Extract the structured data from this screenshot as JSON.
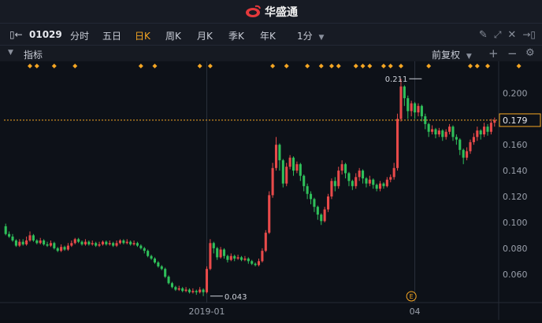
{
  "app": {
    "title": "华盛通"
  },
  "toolbar": {
    "code": "01029",
    "tabs": [
      "分时",
      "五日",
      "日K",
      "周K",
      "月K",
      "季K",
      "年K"
    ],
    "active": "日K",
    "interval": "1分"
  },
  "indicator_bar": {
    "label": "指标",
    "adjust": "前复权"
  },
  "colors": {
    "up": "#e84a4a",
    "down": "#2fbf5a",
    "accent": "#f5a623",
    "bg": "#0d1118"
  },
  "chart_data": {
    "type": "candlestick",
    "ylim": [
      0.038,
      0.216
    ],
    "yticks": [
      "0.200",
      "0.180",
      "0.160",
      "0.140",
      "0.120",
      "0.100",
      "0.080",
      "0.060"
    ],
    "yticks_values": [
      0.2,
      0.18,
      0.16,
      0.14,
      0.12,
      0.1,
      0.08,
      0.06
    ],
    "xticks": [
      {
        "label": "2019-01",
        "index": 58
      },
      {
        "label": "04",
        "index": 118
      }
    ],
    "current_price": {
      "label": "0.179",
      "value": 0.179
    },
    "high_annotation": {
      "label": "0.211",
      "index": 120,
      "value": 0.211
    },
    "low_annotation": {
      "label": "0.043",
      "index": 59,
      "value": 0.043
    },
    "event_marker": {
      "label": "E",
      "index": 117
    },
    "event_dots_indices": [
      7,
      9,
      14,
      20,
      39,
      43,
      56,
      59,
      77,
      81,
      87,
      91,
      94,
      96,
      101,
      103,
      105,
      109,
      111,
      114,
      122,
      134,
      136,
      139,
      148
    ],
    "candles": [
      [
        0.097,
        0.091,
        0.099,
        0.09
      ],
      [
        0.091,
        0.089,
        0.093,
        0.088
      ],
      [
        0.089,
        0.086,
        0.091,
        0.085
      ],
      [
        0.086,
        0.082,
        0.087,
        0.081
      ],
      [
        0.082,
        0.085,
        0.087,
        0.081
      ],
      [
        0.085,
        0.083,
        0.087,
        0.082
      ],
      [
        0.083,
        0.086,
        0.089,
        0.082
      ],
      [
        0.086,
        0.09,
        0.093,
        0.085
      ],
      [
        0.09,
        0.086,
        0.091,
        0.085
      ],
      [
        0.086,
        0.084,
        0.087,
        0.083
      ],
      [
        0.084,
        0.086,
        0.088,
        0.083
      ],
      [
        0.086,
        0.083,
        0.087,
        0.082
      ],
      [
        0.083,
        0.082,
        0.085,
        0.081
      ],
      [
        0.082,
        0.084,
        0.086,
        0.081
      ],
      [
        0.084,
        0.08,
        0.085,
        0.079
      ],
      [
        0.08,
        0.078,
        0.081,
        0.077
      ],
      [
        0.078,
        0.081,
        0.083,
        0.077
      ],
      [
        0.081,
        0.079,
        0.082,
        0.078
      ],
      [
        0.079,
        0.082,
        0.084,
        0.078
      ],
      [
        0.082,
        0.084,
        0.086,
        0.081
      ],
      [
        0.084,
        0.087,
        0.088,
        0.083
      ],
      [
        0.087,
        0.085,
        0.088,
        0.084
      ],
      [
        0.085,
        0.083,
        0.086,
        0.082
      ],
      [
        0.083,
        0.085,
        0.087,
        0.082
      ],
      [
        0.085,
        0.083,
        0.086,
        0.082
      ],
      [
        0.083,
        0.084,
        0.086,
        0.082
      ],
      [
        0.084,
        0.082,
        0.085,
        0.081
      ],
      [
        0.082,
        0.083,
        0.085,
        0.081
      ],
      [
        0.083,
        0.085,
        0.086,
        0.082
      ],
      [
        0.085,
        0.083,
        0.086,
        0.082
      ],
      [
        0.083,
        0.084,
        0.086,
        0.082
      ],
      [
        0.084,
        0.082,
        0.085,
        0.081
      ],
      [
        0.082,
        0.084,
        0.086,
        0.081
      ],
      [
        0.084,
        0.086,
        0.087,
        0.083
      ],
      [
        0.086,
        0.084,
        0.087,
        0.083
      ],
      [
        0.084,
        0.085,
        0.087,
        0.083
      ],
      [
        0.085,
        0.083,
        0.086,
        0.082
      ],
      [
        0.083,
        0.084,
        0.086,
        0.082
      ],
      [
        0.084,
        0.082,
        0.085,
        0.081
      ],
      [
        0.082,
        0.08,
        0.083,
        0.079
      ],
      [
        0.08,
        0.078,
        0.081,
        0.076
      ],
      [
        0.078,
        0.074,
        0.079,
        0.073
      ],
      [
        0.074,
        0.072,
        0.075,
        0.071
      ],
      [
        0.072,
        0.069,
        0.073,
        0.068
      ],
      [
        0.069,
        0.066,
        0.07,
        0.065
      ],
      [
        0.066,
        0.064,
        0.067,
        0.063
      ],
      [
        0.064,
        0.058,
        0.065,
        0.057
      ],
      [
        0.058,
        0.053,
        0.059,
        0.052
      ],
      [
        0.053,
        0.05,
        0.054,
        0.049
      ],
      [
        0.05,
        0.048,
        0.051,
        0.047
      ],
      [
        0.048,
        0.049,
        0.051,
        0.047
      ],
      [
        0.049,
        0.047,
        0.05,
        0.046
      ],
      [
        0.047,
        0.048,
        0.05,
        0.046
      ],
      [
        0.048,
        0.046,
        0.049,
        0.045
      ],
      [
        0.046,
        0.047,
        0.049,
        0.045
      ],
      [
        0.047,
        0.046,
        0.048,
        0.044
      ],
      [
        0.046,
        0.048,
        0.05,
        0.045
      ],
      [
        0.048,
        0.046,
        0.049,
        0.043
      ],
      [
        0.046,
        0.064,
        0.066,
        0.045
      ],
      [
        0.064,
        0.084,
        0.087,
        0.063
      ],
      [
        0.084,
        0.08,
        0.085,
        0.076
      ],
      [
        0.08,
        0.073,
        0.081,
        0.071
      ],
      [
        0.073,
        0.079,
        0.081,
        0.072
      ],
      [
        0.079,
        0.074,
        0.08,
        0.072
      ],
      [
        0.074,
        0.071,
        0.075,
        0.069
      ],
      [
        0.071,
        0.074,
        0.076,
        0.07
      ],
      [
        0.074,
        0.072,
        0.075,
        0.07
      ],
      [
        0.072,
        0.073,
        0.075,
        0.071
      ],
      [
        0.073,
        0.071,
        0.074,
        0.07
      ],
      [
        0.071,
        0.072,
        0.074,
        0.07
      ],
      [
        0.072,
        0.07,
        0.073,
        0.068
      ],
      [
        0.07,
        0.068,
        0.071,
        0.067
      ],
      [
        0.068,
        0.067,
        0.069,
        0.066
      ],
      [
        0.067,
        0.07,
        0.072,
        0.066
      ],
      [
        0.07,
        0.078,
        0.08,
        0.069
      ],
      [
        0.078,
        0.092,
        0.094,
        0.077
      ],
      [
        0.092,
        0.121,
        0.124,
        0.091
      ],
      [
        0.121,
        0.142,
        0.146,
        0.119
      ],
      [
        0.142,
        0.16,
        0.166,
        0.14
      ],
      [
        0.16,
        0.148,
        0.161,
        0.14
      ],
      [
        0.148,
        0.13,
        0.149,
        0.127
      ],
      [
        0.13,
        0.143,
        0.146,
        0.128
      ],
      [
        0.143,
        0.15,
        0.152,
        0.141
      ],
      [
        0.15,
        0.14,
        0.151,
        0.136
      ],
      [
        0.14,
        0.145,
        0.147,
        0.138
      ],
      [
        0.145,
        0.136,
        0.146,
        0.132
      ],
      [
        0.136,
        0.128,
        0.137,
        0.124
      ],
      [
        0.128,
        0.122,
        0.13,
        0.118
      ],
      [
        0.122,
        0.118,
        0.124,
        0.114
      ],
      [
        0.118,
        0.112,
        0.119,
        0.108
      ],
      [
        0.112,
        0.106,
        0.113,
        0.102
      ],
      [
        0.106,
        0.101,
        0.107,
        0.098
      ],
      [
        0.101,
        0.11,
        0.112,
        0.1
      ],
      [
        0.11,
        0.12,
        0.122,
        0.108
      ],
      [
        0.12,
        0.132,
        0.134,
        0.118
      ],
      [
        0.132,
        0.128,
        0.135,
        0.124
      ],
      [
        0.128,
        0.14,
        0.143,
        0.126
      ],
      [
        0.14,
        0.145,
        0.148,
        0.137
      ],
      [
        0.145,
        0.138,
        0.146,
        0.134
      ],
      [
        0.138,
        0.132,
        0.139,
        0.128
      ],
      [
        0.132,
        0.128,
        0.133,
        0.125
      ],
      [
        0.128,
        0.135,
        0.138,
        0.126
      ],
      [
        0.135,
        0.14,
        0.142,
        0.132
      ],
      [
        0.14,
        0.134,
        0.141,
        0.13
      ],
      [
        0.134,
        0.13,
        0.135,
        0.127
      ],
      [
        0.13,
        0.133,
        0.136,
        0.128
      ],
      [
        0.133,
        0.129,
        0.134,
        0.126
      ],
      [
        0.129,
        0.126,
        0.13,
        0.124
      ],
      [
        0.126,
        0.13,
        0.132,
        0.124
      ],
      [
        0.13,
        0.128,
        0.131,
        0.126
      ],
      [
        0.128,
        0.133,
        0.135,
        0.127
      ],
      [
        0.133,
        0.135,
        0.137,
        0.131
      ],
      [
        0.135,
        0.142,
        0.146,
        0.133
      ],
      [
        0.142,
        0.18,
        0.184,
        0.14
      ],
      [
        0.18,
        0.205,
        0.211,
        0.178
      ],
      [
        0.205,
        0.196,
        0.206,
        0.19
      ],
      [
        0.196,
        0.186,
        0.198,
        0.18
      ],
      [
        0.186,
        0.192,
        0.194,
        0.182
      ],
      [
        0.192,
        0.185,
        0.193,
        0.18
      ],
      [
        0.185,
        0.19,
        0.192,
        0.182
      ],
      [
        0.19,
        0.182,
        0.191,
        0.178
      ],
      [
        0.182,
        0.176,
        0.184,
        0.172
      ],
      [
        0.176,
        0.17,
        0.177,
        0.166
      ],
      [
        0.17,
        0.172,
        0.175,
        0.168
      ],
      [
        0.172,
        0.168,
        0.173,
        0.165
      ],
      [
        0.168,
        0.171,
        0.173,
        0.166
      ],
      [
        0.171,
        0.166,
        0.172,
        0.163
      ],
      [
        0.166,
        0.17,
        0.172,
        0.164
      ],
      [
        0.17,
        0.174,
        0.176,
        0.168
      ],
      [
        0.174,
        0.166,
        0.175,
        0.163
      ],
      [
        0.166,
        0.164,
        0.168,
        0.16
      ],
      [
        0.164,
        0.156,
        0.165,
        0.152
      ],
      [
        0.156,
        0.15,
        0.157,
        0.145
      ],
      [
        0.15,
        0.155,
        0.158,
        0.148
      ],
      [
        0.155,
        0.162,
        0.164,
        0.153
      ],
      [
        0.162,
        0.166,
        0.169,
        0.16
      ],
      [
        0.166,
        0.171,
        0.174,
        0.163
      ],
      [
        0.171,
        0.168,
        0.172,
        0.164
      ],
      [
        0.168,
        0.174,
        0.177,
        0.166
      ],
      [
        0.174,
        0.17,
        0.176,
        0.167
      ],
      [
        0.17,
        0.177,
        0.18,
        0.168
      ],
      [
        0.177,
        0.179,
        0.181,
        0.174
      ]
    ]
  }
}
